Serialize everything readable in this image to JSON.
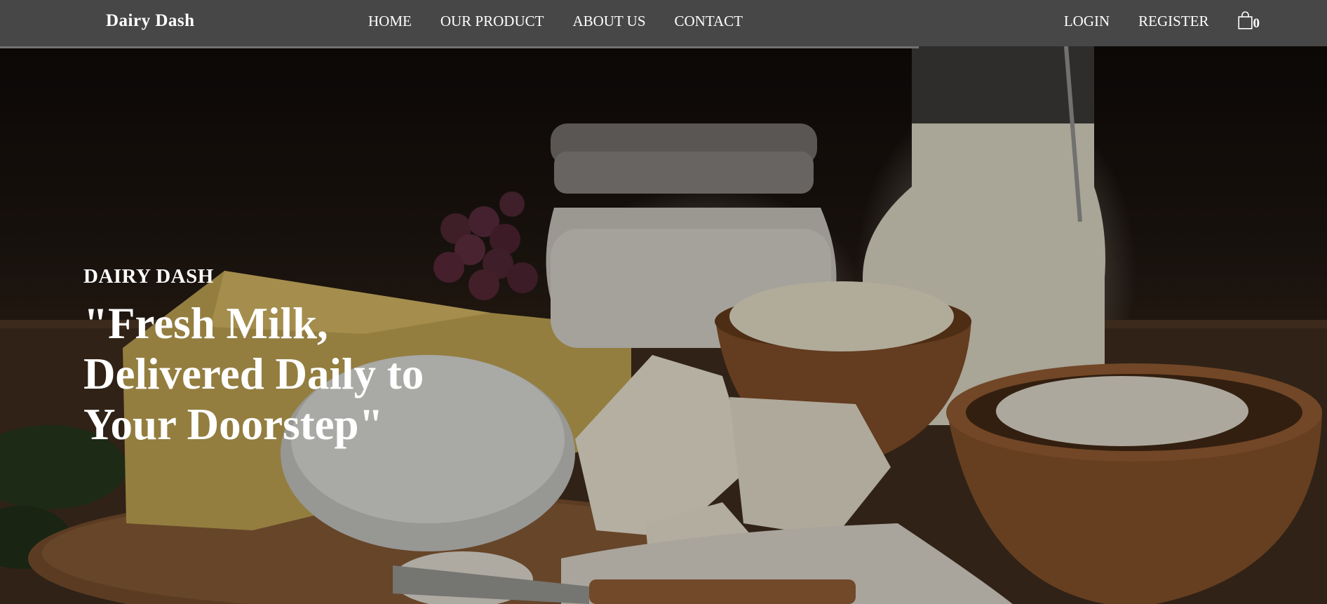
{
  "nav": {
    "brand": "Dairy Dash",
    "links": [
      {
        "label": "HOME"
      },
      {
        "label": "OUR PRODUCT"
      },
      {
        "label": "ABOUT US"
      },
      {
        "label": "CONTACT"
      }
    ],
    "login_label": "LOGIN",
    "register_label": "REGISTER",
    "cart_icon": "shopping-bag-icon",
    "cart_count": "0"
  },
  "hero": {
    "kicker": "DAIRY DASH",
    "headline": "\"Fresh Milk, Delivered Daily to Your Doorstep\""
  },
  "colors": {
    "navbar_bg": "#474747",
    "text": "#ffffff"
  }
}
